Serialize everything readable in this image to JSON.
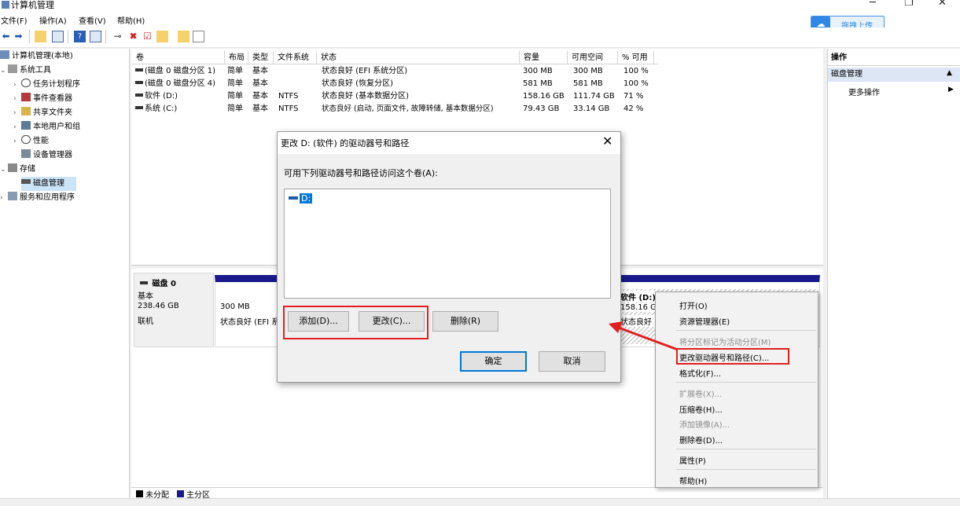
{
  "window": {
    "title": "计算机管理",
    "minimize": "─",
    "maximize": "❐",
    "close": "✕"
  },
  "menu": [
    "文件(F)",
    "操作(A)",
    "查看(V)",
    "帮助(H)"
  ],
  "upload": {
    "label": "拖拽上传"
  },
  "tree": {
    "root": "计算机管理(本地)",
    "system_tools": "系统工具",
    "task_scheduler": "任务计划程序",
    "event_viewer": "事件查看器",
    "shared_folders": "共享文件夹",
    "local_users": "本地用户和组",
    "performance": "性能",
    "device_manager": "设备管理器",
    "storage": "存储",
    "disk_management": "磁盘管理",
    "services": "服务和应用程序"
  },
  "volumes": {
    "headers": [
      "卷",
      "布局",
      "类型",
      "文件系统",
      "状态",
      "容量",
      "可用空间",
      "% 可用"
    ],
    "rows": [
      [
        "(磁盘 0 磁盘分区 1)",
        "简单",
        "基本",
        "",
        "状态良好 (EFI 系统分区)",
        "300 MB",
        "300 MB",
        "100 %"
      ],
      [
        "(磁盘 0 磁盘分区 4)",
        "简单",
        "基本",
        "",
        "状态良好 (恢复分区)",
        "581 MB",
        "581 MB",
        "100 %"
      ],
      [
        "软件 (D:)",
        "简单",
        "基本",
        "NTFS",
        "状态良好 (基本数据分区)",
        "158.16 GB",
        "111.74 GB",
        "71 %"
      ],
      [
        "系统 (C:)",
        "简单",
        "基本",
        "NTFS",
        "状态良好 (启动, 页面文件, 故障转储, 基本数据分区)",
        "79.43 GB",
        "33.14 GB",
        "42 %"
      ]
    ]
  },
  "disk": {
    "name": "磁盘 0",
    "type": "基本",
    "size": "238.46 GB",
    "status": "联机",
    "part1_size": "300 MB",
    "part1_status": "状态良好 (EFI 系",
    "part3_name": "软件 (D:)",
    "part3_size": "158.16 G",
    "part3_status": "状态良好"
  },
  "legend": {
    "unallocated": "未分配",
    "primary": "主分区"
  },
  "actions": {
    "title": "操作",
    "section": "磁盘管理",
    "more": "更多操作"
  },
  "dialog": {
    "title": "更改 D: (软件) 的驱动器号和路径",
    "description": "可用下列驱动器号和路径访问这个卷(A):",
    "drive_item": "D:",
    "add": "添加(D)...",
    "change": "更改(C)...",
    "remove": "删除(R)",
    "ok": "确定",
    "cancel": "取消"
  },
  "context_menu": {
    "open": "打开(O)",
    "explorer": "资源管理器(E)",
    "mark_active": "将分区标记为活动分区(M)",
    "change_letter": "更改驱动器号和路径(C)...",
    "format": "格式化(F)...",
    "extend": "扩展卷(X)...",
    "shrink": "压缩卷(H)...",
    "add_mirror": "添加镜像(A)...",
    "delete": "删除卷(D)...",
    "properties": "属性(P)",
    "help": "帮助(H)"
  },
  "colors": {
    "primary_partition": "#19198c",
    "highlight": "#e02020",
    "selection": "#0078d7"
  }
}
